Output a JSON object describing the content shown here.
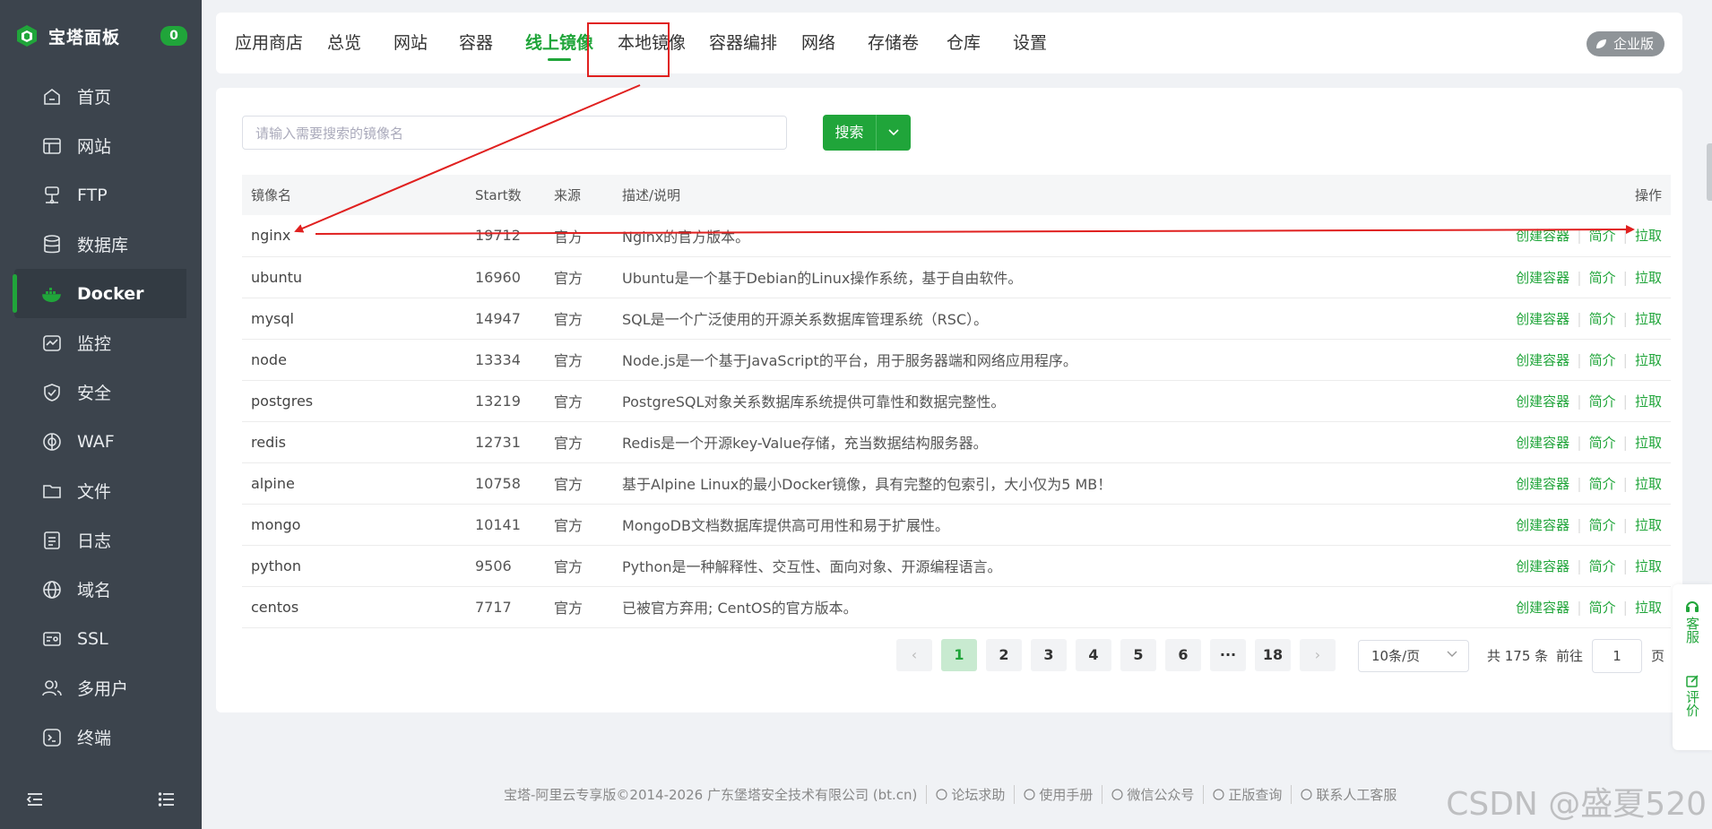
{
  "sidebar": {
    "brand": "宝塔面板",
    "badge": "0",
    "items": [
      {
        "label": "首页",
        "icon": "home-icon"
      },
      {
        "label": "网站",
        "icon": "website-icon"
      },
      {
        "label": "FTP",
        "icon": "ftp-icon"
      },
      {
        "label": "数据库",
        "icon": "database-icon"
      },
      {
        "label": "Docker",
        "icon": "docker-icon",
        "active": true
      },
      {
        "label": "监控",
        "icon": "monitor-icon"
      },
      {
        "label": "安全",
        "icon": "security-icon"
      },
      {
        "label": "WAF",
        "icon": "waf-icon"
      },
      {
        "label": "文件",
        "icon": "folder-icon"
      },
      {
        "label": "日志",
        "icon": "log-icon"
      },
      {
        "label": "域名",
        "icon": "globe-icon"
      },
      {
        "label": "SSL",
        "icon": "ssl-icon"
      },
      {
        "label": "多用户",
        "icon": "users-icon"
      },
      {
        "label": "终端",
        "icon": "terminal-icon"
      }
    ]
  },
  "tabs": [
    "应用商店",
    "总览",
    "网站",
    "容器",
    "线上镜像",
    "本地镜像",
    "容器编排",
    "网络",
    "存储卷",
    "仓库",
    "设置"
  ],
  "active_tab": "线上镜像",
  "enterprise_label": "企业版",
  "search": {
    "placeholder": "请输入需要搜索的镜像名",
    "button": "搜索"
  },
  "table": {
    "headers": {
      "name": "镜像名",
      "stars": "Start数",
      "source": "来源",
      "desc": "描述/说明",
      "ops": "操作"
    },
    "ops": {
      "create": "创建容器",
      "intro": "简介",
      "pull": "拉取"
    },
    "rows": [
      {
        "name": "nginx",
        "stars": "19712",
        "source": "官方",
        "desc": "Nginx的官方版本。"
      },
      {
        "name": "ubuntu",
        "stars": "16960",
        "source": "官方",
        "desc": "Ubuntu是一个基于Debian的Linux操作系统，基于自由软件。"
      },
      {
        "name": "mysql",
        "stars": "14947",
        "source": "官方",
        "desc": "SQL是一个广泛使用的开源关系数据库管理系统（RSC）。"
      },
      {
        "name": "node",
        "stars": "13334",
        "source": "官方",
        "desc": "Node.js是一个基于JavaScript的平台，用于服务器端和网络应用程序。"
      },
      {
        "name": "postgres",
        "stars": "13219",
        "source": "官方",
        "desc": "PostgreSQL对象关系数据库系统提供可靠性和数据完整性。"
      },
      {
        "name": "redis",
        "stars": "12731",
        "source": "官方",
        "desc": "Redis是一个开源key-Value存储，充当数据结构服务器。"
      },
      {
        "name": "alpine",
        "stars": "10758",
        "source": "官方",
        "desc": "基于Alpine Linux的最小Docker镜像，具有完整的包索引，大小仅为5 MB！"
      },
      {
        "name": "mongo",
        "stars": "10141",
        "source": "官方",
        "desc": "MongoDB文档数据库提供高可用性和易于扩展性。"
      },
      {
        "name": "python",
        "stars": "9506",
        "source": "官方",
        "desc": "Python是一种解释性、交互性、面向对象、开源编程语言。"
      },
      {
        "name": "centos",
        "stars": "7717",
        "source": "官方",
        "desc": "已被官方弃用; CentOS的官方版本。"
      }
    ]
  },
  "pagination": {
    "prev": "‹",
    "pages": [
      "1",
      "2",
      "3",
      "4",
      "5",
      "6",
      "···",
      "18"
    ],
    "current": "1",
    "next": "›",
    "page_size": "10条/页",
    "total": "共 175 条",
    "goto_label": "前往",
    "goto_value": "1",
    "page_unit": "页"
  },
  "float_panel": {
    "service": "客服",
    "review": "评价"
  },
  "footer": {
    "copyright": "宝塔-阿里云专享版©2014-2026 广东堡塔安全技术有限公司 (bt.cn)",
    "links": [
      {
        "label": "论坛求助",
        "icon": "help-icon"
      },
      {
        "label": "使用手册",
        "icon": "manual-icon"
      },
      {
        "label": "微信公众号",
        "icon": "wechat-icon"
      },
      {
        "label": "正版查询",
        "icon": "verify-icon"
      },
      {
        "label": "联系人工客服",
        "icon": "support-icon"
      }
    ]
  },
  "watermark": "CSDN @盛夏520",
  "colors": {
    "brand_green": "#20a53a",
    "sidebar_bg": "#3c444d",
    "annotation_red": "#e0201f"
  }
}
